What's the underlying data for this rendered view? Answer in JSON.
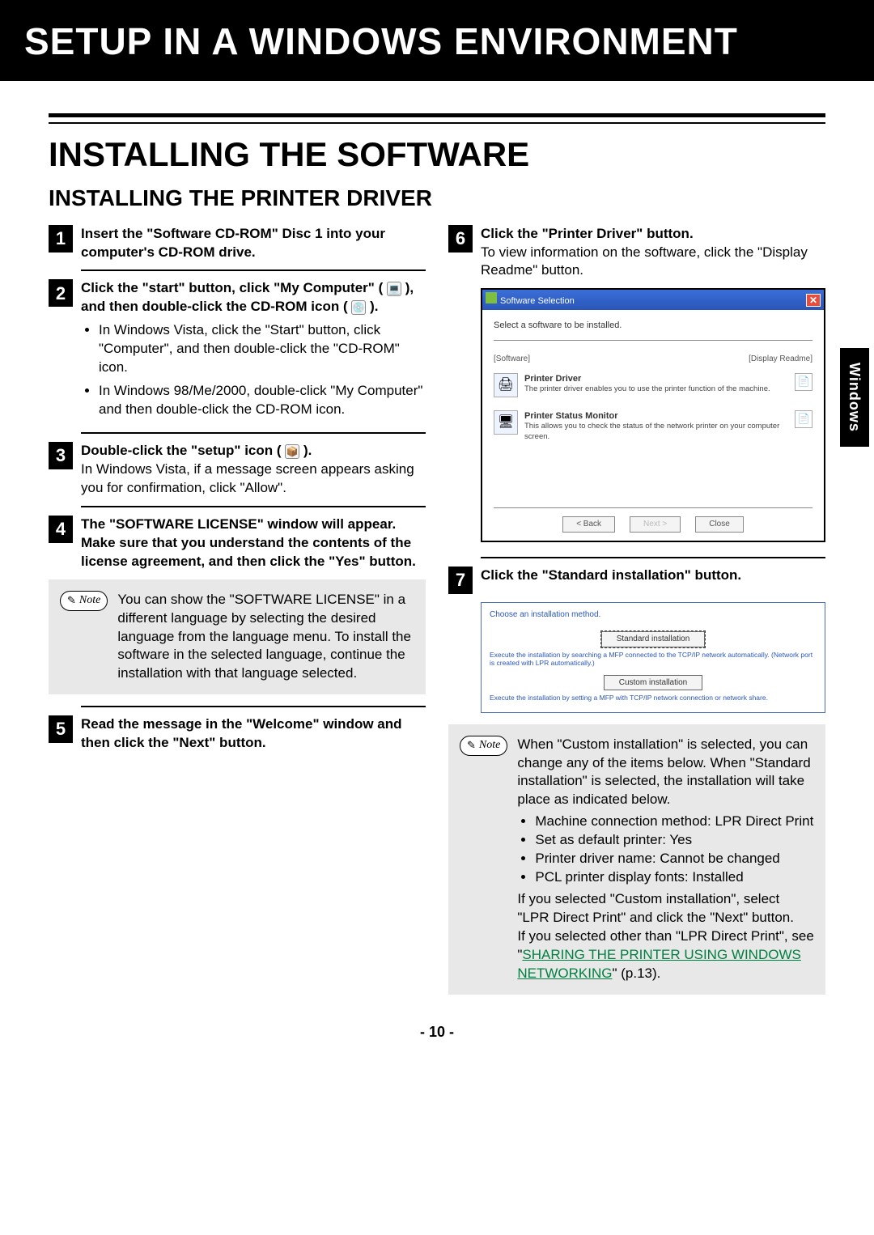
{
  "banner": {
    "title": "SETUP IN A WINDOWS ENVIRONMENT"
  },
  "section": {
    "h2": "INSTALLING THE SOFTWARE",
    "h3": "INSTALLING THE PRINTER DRIVER"
  },
  "sidetab": "Windows",
  "pagenum": "- 10 -",
  "left": {
    "step1": {
      "num": "1",
      "title": "Insert the \"Software CD-ROM\" Disc 1 into your computer's CD-ROM drive."
    },
    "step2": {
      "num": "2",
      "title_a": "Click the \"start\" button, click \"My Computer\" (",
      "title_b": "), and then double-click the CD-ROM icon (",
      "title_c": ").",
      "bullet1": "In Windows Vista, click the \"Start\" button, click \"Computer\", and then double-click the \"CD-ROM\" icon.",
      "bullet2": "In Windows 98/Me/2000, double-click \"My Computer\" and then double-click the CD-ROM icon."
    },
    "step3": {
      "num": "3",
      "title_a": "Double-click the \"setup\" icon (",
      "title_b": ").",
      "desc": "In Windows Vista, if a message screen appears asking you for confirmation, click \"Allow\"."
    },
    "step4": {
      "num": "4",
      "title": "The \"SOFTWARE LICENSE\" window will appear. Make sure that you understand the contents of the license agreement, and then click the \"Yes\" button."
    },
    "note1": {
      "label": "Note",
      "text": "You can show the \"SOFTWARE LICENSE\" in a different language by selecting the desired language from the language menu. To install the software in the selected language, continue the installation with that language selected."
    },
    "step5": {
      "num": "5",
      "title": "Read the message in the \"Welcome\" window and then click the \"Next\" button."
    }
  },
  "right": {
    "step6": {
      "num": "6",
      "title": "Click the \"Printer Driver\" button.",
      "desc": "To view information on the software, click the \"Display Readme\" button."
    },
    "ss1": {
      "windowtitle": "Software Selection",
      "label_top": "Select a software to be installed.",
      "label_software": "[Software]",
      "label_readme": "[Display Readme]",
      "item1": {
        "title": "Printer Driver",
        "desc": "The printer driver enables you to use the printer function of the machine."
      },
      "item2": {
        "title": "Printer Status Monitor",
        "desc": "This allows you to check the status of the network printer on your computer screen."
      },
      "btn_back": "< Back",
      "btn_next": "Next >",
      "btn_close": "Close"
    },
    "step7": {
      "num": "7",
      "title": "Click the \"Standard installation\" button."
    },
    "ss2": {
      "head": "Choose an installation method.",
      "opt1": {
        "label": "Standard installation",
        "desc": "Execute the installation by searching a MFP connected to the TCP/IP network automatically. (Network port is created with LPR automatically.)"
      },
      "opt2": {
        "label": "Custom installation",
        "desc": "Execute the installation by setting a MFP with TCP/IP network connection or network share."
      }
    },
    "note2": {
      "label": "Note",
      "intro": "When \"Custom installation\" is selected, you can change any of the items below. When \"Standard installation\" is selected, the installation will take place as indicated below.",
      "b1": "Machine connection method: LPR Direct Print",
      "b2": "Set as default printer: Yes",
      "b3": "Printer driver name: Cannot be changed",
      "b4": "PCL printer display fonts: Installed",
      "after1": "If you selected \"Custom installation\", select \"LPR Direct Print\" and click the \"Next\" button.",
      "after2_a": "If you selected other than \"LPR Direct Print\", see \"",
      "link": "SHARING THE PRINTER USING WINDOWS NETWORKING",
      "after2_b": "\" (p.13)."
    }
  }
}
